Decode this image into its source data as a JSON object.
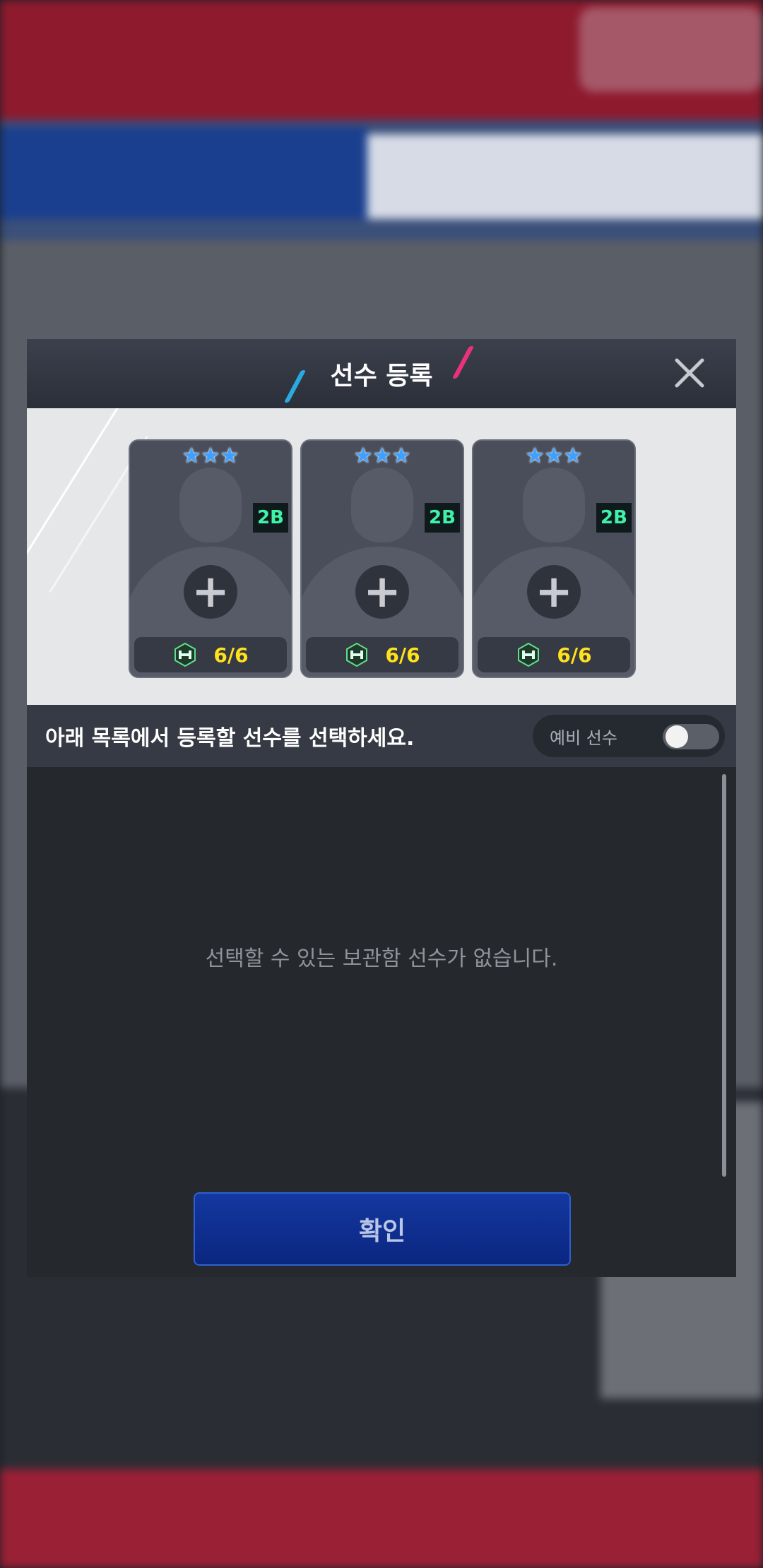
{
  "modal": {
    "title": "선수 등록",
    "close_icon": "close-icon"
  },
  "cards": [
    {
      "stars": "★★★",
      "position": "2B",
      "count": "6/6",
      "icon": "stat-hexagon-icon",
      "action_icon": "plus-icon"
    },
    {
      "stars": "★★★",
      "position": "2B",
      "count": "6/6",
      "icon": "stat-hexagon-icon",
      "action_icon": "plus-icon"
    },
    {
      "stars": "★★★",
      "position": "2B",
      "count": "6/6",
      "icon": "stat-hexagon-icon",
      "action_icon": "plus-icon"
    }
  ],
  "info": {
    "instruction": "아래 목록에서 등록할 선수를 선택하세요.",
    "toggle_label": "예비 선수",
    "toggle_on": false
  },
  "list": {
    "empty_message": "선택할 수 있는 보관함 선수가 없습니다."
  },
  "actions": {
    "confirm_label": "확인"
  },
  "colors": {
    "position_badge_text": "#3ff2a8",
    "count_text": "#ffe21c",
    "confirm_bg": "#1338a0",
    "slash_left": "#2aa9e0",
    "slash_right": "#e8327a"
  }
}
